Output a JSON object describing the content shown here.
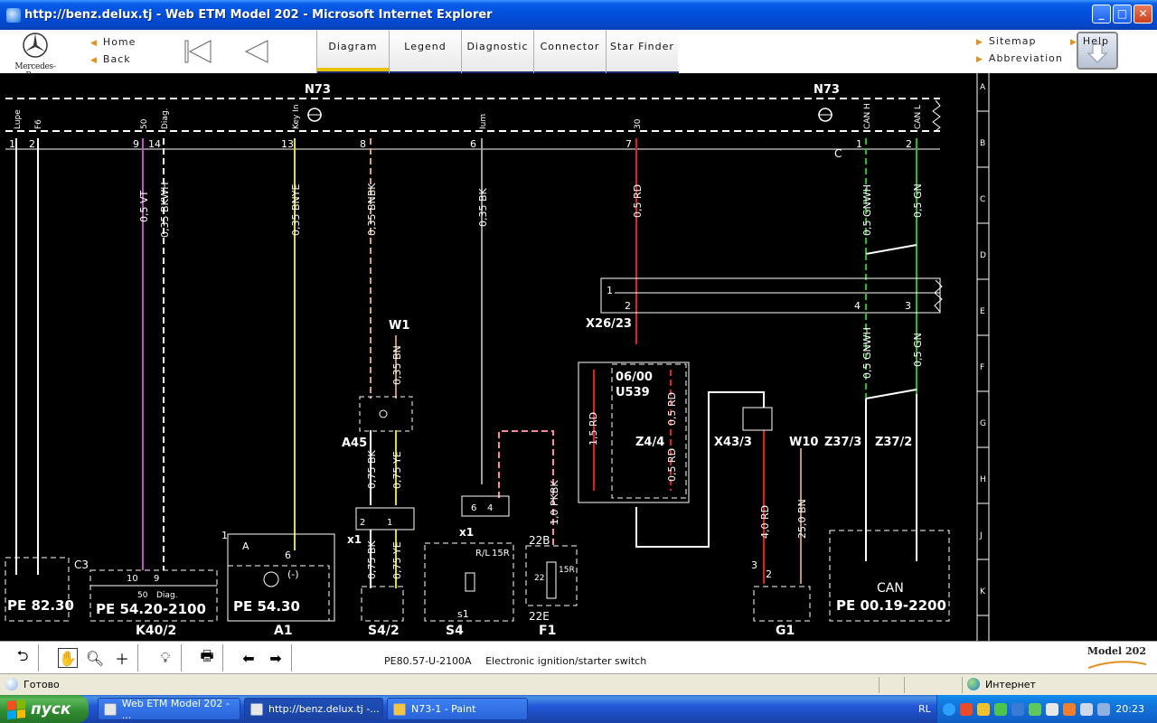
{
  "window": {
    "title": "http://benz.delux.tj - Web ETM Model 202 - Microsoft Internet Explorer",
    "minimize": "_",
    "maximize": "□",
    "close": "✕"
  },
  "brand": {
    "logo_text": "Mercedes-Benz"
  },
  "nav": {
    "home": "Home",
    "back": "Back",
    "sitemap": "Sitemap",
    "abbreviation": "Abbreviation",
    "help": "Help"
  },
  "tabs": [
    {
      "label": "Diagram",
      "active": true
    },
    {
      "label": "Legend",
      "active": false
    },
    {
      "label": "Diagnostic",
      "active": false
    },
    {
      "label": "Connector",
      "active": false
    },
    {
      "label": "Star Finder",
      "active": false
    }
  ],
  "diagram": {
    "row_labels": [
      "A",
      "B",
      "C",
      "D",
      "E",
      "F",
      "G",
      "H",
      "J",
      "K"
    ],
    "components": {
      "n73_left": "N73",
      "n73_right": "N73",
      "w1": "W1",
      "a45": "A45",
      "x26_23": "X26/23",
      "u539_a": "06/00",
      "u539_b": "U539",
      "z4_4": "Z4/4",
      "x43_3": "X43/3",
      "w10": "W10",
      "z37_3": "Z37/3",
      "z37_2": "Z37/2",
      "k40_2": "K40/2",
      "a1": "A1",
      "s4_2": "S4/2",
      "s4": "S4",
      "f1": "F1",
      "g1": "G1",
      "x1_a": "x1",
      "x1_b": "x1",
      "c3": "C3",
      "c": "C",
      "f22b": "22B",
      "f22e": "22E",
      "can": "CAN"
    },
    "pin_names": [
      "Lupe",
      "F6",
      "50",
      "Diag.",
      "Key In",
      "Ium",
      "30",
      "CAN H",
      "CAN L"
    ],
    "pin_numbers": [
      "1",
      "2",
      "9",
      "14",
      "13",
      "8",
      "6",
      "7",
      "1",
      "2"
    ],
    "wires": {
      "vt": "0,5 VT",
      "bkwh": "0,35 BKWH",
      "bnye": "0,35 BNYE",
      "bnbk": "0,35 BNBK",
      "bk": "0,35 BK",
      "rd1": "0,5 RD",
      "gnwh1": "0,5 GNWH",
      "gn1": "0,5 GN",
      "bn035": "0,35 BN",
      "gnwh2": "0,5 GNWH",
      "gn2": "0,5 GN",
      "rd15": "1,5 RD",
      "rd05a": "0,5 RD",
      "rd05b": "0,5 RD",
      "bk075a": "0,75 BK",
      "ye075a": "0,75 YE",
      "bk075b": "0,75 BK",
      "ye075b": "0,75 YE",
      "pkbk": "1,0 PKBK",
      "rd40": "4,0 RD",
      "bn25": "25,0 BN"
    },
    "refs": {
      "pe8230": "PE 82.30",
      "pe5420": "PE 54.20-2100",
      "pe5430": "PE 54.30",
      "pe0019": "PE 00.19-2200"
    },
    "small_labels": {
      "k40_50": "50",
      "k40_diag": "Diag.",
      "k40_10": "10",
      "k40_9": "9",
      "a1_a": "A",
      "a1_6": "6",
      "a1_1": "1",
      "a1_minus": "(-)",
      "x26_1": "1",
      "x26_2": "2",
      "x26_4": "4",
      "x26_3": "3",
      "x1a_2": "2",
      "x1a_1": "1",
      "x1b_6": "6",
      "x1b_4": "4",
      "s4_rl": "R/L",
      "s4_15r": "15R",
      "s4_s1": "s1",
      "f1_22": "22",
      "f1_15r": "15R",
      "g1_3": "3",
      "g1_2": "2"
    }
  },
  "footer": {
    "doc_code": "PE80.57-U-2100A",
    "doc_title": "Electronic ignition/starter switch",
    "model": "Model 202"
  },
  "status": {
    "left": "Готово",
    "zone": "Интернет"
  },
  "taskbar": {
    "start": "пуск",
    "items": [
      {
        "label": "Web ETM Model 202 - ..."
      },
      {
        "label": "http://benz.delux.tj -..."
      },
      {
        "label": "N73-1 - Paint"
      }
    ],
    "lang": "RL",
    "clock": "20:23"
  },
  "colors": {
    "wire_violet": "#c050c0",
    "wire_yellow": "#e8e000",
    "wire_orange": "#e0a070",
    "wire_gray": "#a0a0a0",
    "wire_red": "#e02020",
    "wire_green": "#20c020",
    "wire_brown": "#c89060",
    "wire_pink": "#ff8aa0",
    "tab_active_bar": "#e8c400"
  }
}
